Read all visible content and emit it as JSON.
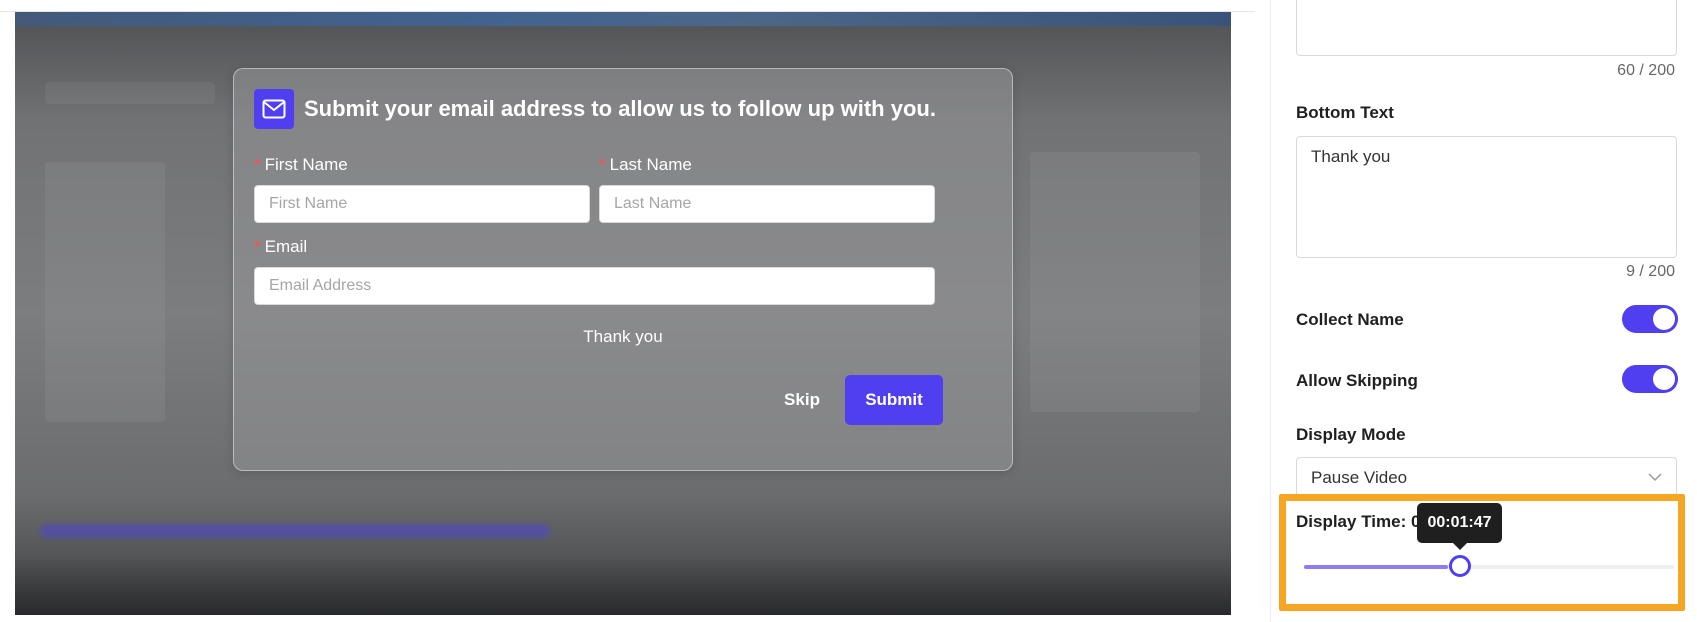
{
  "modal": {
    "title": "Submit your email address to allow us to follow up with you.",
    "first_name_label": "First Name",
    "first_name_placeholder": "First Name",
    "last_name_label": "Last Name",
    "last_name_placeholder": "Last Name",
    "email_label": "Email",
    "email_placeholder": "Email Address",
    "required_marker": "*",
    "bottom_text": "Thank you",
    "skip_label": "Skip",
    "submit_label": "Submit"
  },
  "settings": {
    "top_text_counter": "60 / 200",
    "bottom_text_label": "Bottom Text",
    "bottom_text_value": "Thank you",
    "bottom_text_counter": "9 / 200",
    "collect_name_label": "Collect Name",
    "collect_name_on": true,
    "allow_skipping_label": "Allow Skipping",
    "allow_skipping_on": true,
    "display_mode_label": "Display Mode",
    "display_mode_value": "Pause Video",
    "display_time_label": "Display Time: 0",
    "display_time_tooltip": "00:01:47",
    "display_time_fraction": 0.39
  },
  "colors": {
    "accent": "#4f3ff0",
    "highlight": "#f5a623",
    "required": "#ff4d4f"
  },
  "icons": {
    "modal_icon": "mail-icon",
    "select_icon": "chevron-down-icon"
  }
}
